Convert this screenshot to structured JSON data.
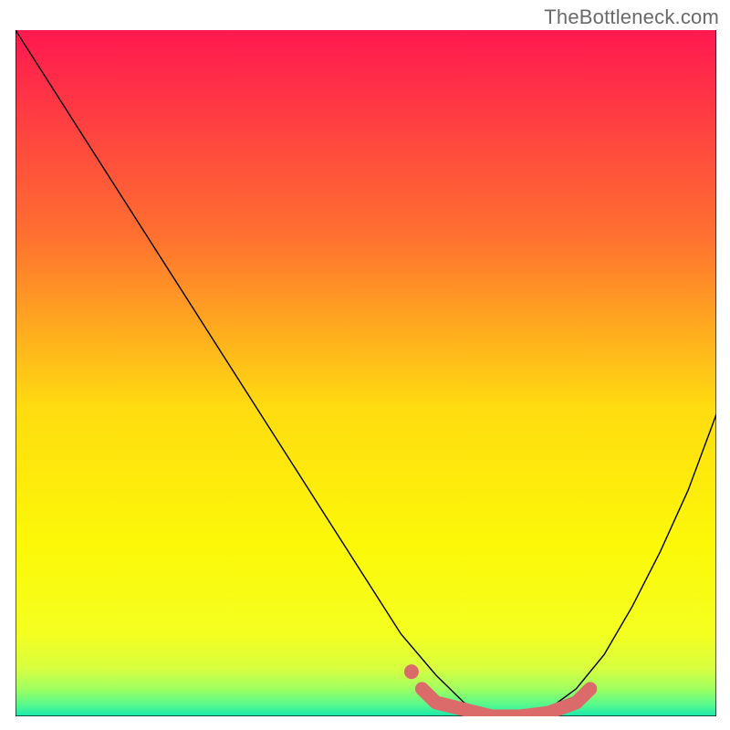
{
  "watermark": "TheBottleneck.com",
  "chart_data": {
    "type": "line",
    "title": "",
    "xlabel": "",
    "ylabel": "",
    "xlim": [
      0,
      100
    ],
    "ylim": [
      0,
      100
    ],
    "series": [
      {
        "name": "bottleneck-curve",
        "x": [
          0,
          5,
          10,
          15,
          20,
          25,
          30,
          35,
          40,
          45,
          50,
          55,
          60,
          64,
          68,
          72,
          76,
          80,
          84,
          88,
          92,
          96,
          100
        ],
        "values": [
          100,
          92,
          84,
          76,
          68,
          60,
          52,
          44,
          36,
          28,
          20,
          12,
          6,
          2,
          0,
          0,
          1,
          4,
          9,
          16,
          24,
          33,
          44
        ]
      }
    ],
    "highlight": {
      "name": "optimal-range",
      "x": [
        58,
        60,
        64,
        68,
        72,
        76,
        80,
        82
      ],
      "values": [
        4,
        2,
        1,
        0,
        0,
        0.5,
        2,
        4
      ]
    },
    "background_gradient": {
      "stops": [
        {
          "pos": 0.0,
          "color": "#ff1850"
        },
        {
          "pos": 0.3,
          "color": "#ff7030"
        },
        {
          "pos": 0.55,
          "color": "#ffdc10"
        },
        {
          "pos": 0.75,
          "color": "#fcf808"
        },
        {
          "pos": 0.88,
          "color": "#f4ff20"
        },
        {
          "pos": 0.93,
          "color": "#d8ff40"
        },
        {
          "pos": 0.96,
          "color": "#a0ff60"
        },
        {
          "pos": 0.985,
          "color": "#50f890"
        },
        {
          "pos": 1.0,
          "color": "#18e8b0"
        }
      ]
    }
  }
}
